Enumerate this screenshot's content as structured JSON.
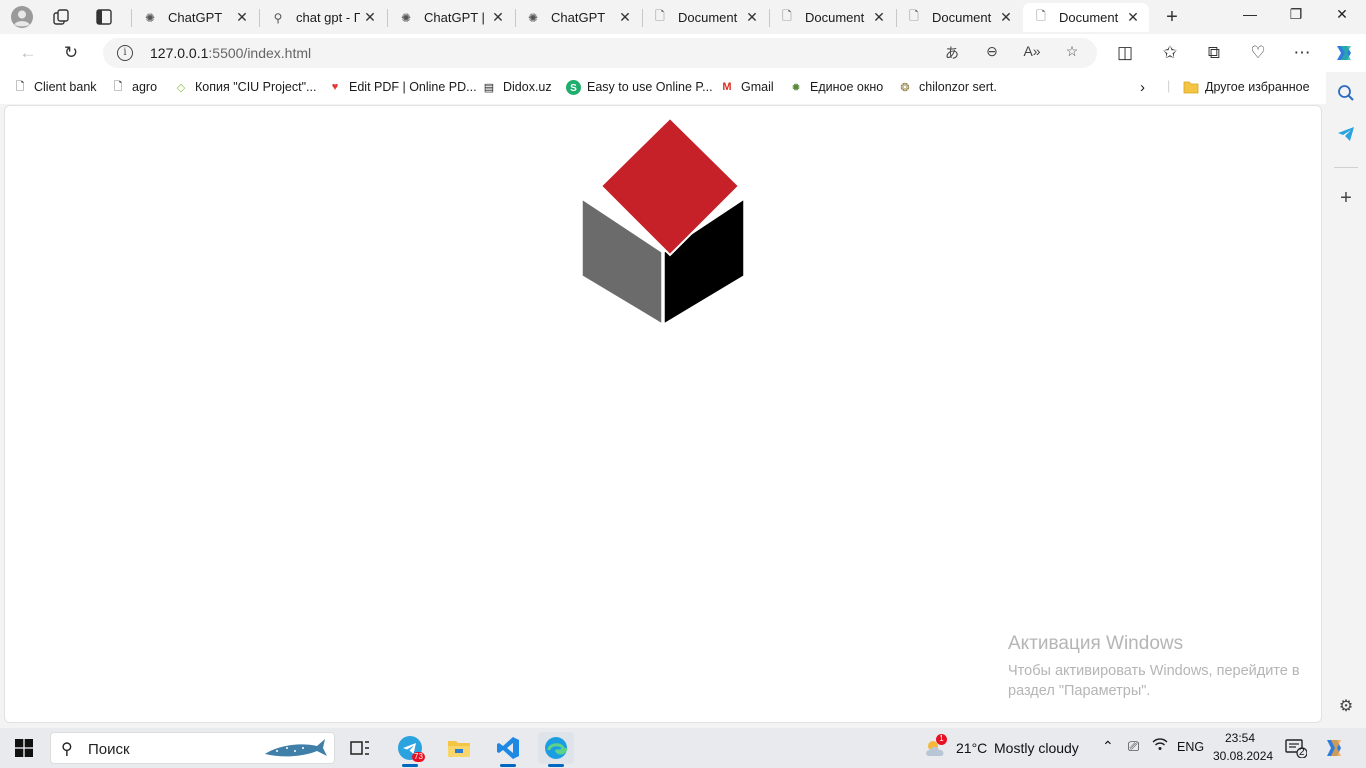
{
  "tabs": [
    {
      "label": "ChatGPT",
      "icon": "chatgpt-icon"
    },
    {
      "label": "chat gpt - По",
      "icon": "search-icon"
    },
    {
      "label": "ChatGPT | O",
      "icon": "chatgpt-icon"
    },
    {
      "label": "ChatGPT",
      "icon": "chatgpt-icon"
    },
    {
      "label": "Document",
      "icon": "page-icon"
    },
    {
      "label": "Document",
      "icon": "page-icon"
    },
    {
      "label": "Document",
      "icon": "page-icon"
    },
    {
      "label": "Document",
      "icon": "page-icon",
      "active": true
    }
  ],
  "address": {
    "host": "127.0.0.1",
    "path": ":5500/index.html"
  },
  "favorites": [
    {
      "label": "Client bank",
      "icon": "page-icon"
    },
    {
      "label": "agro",
      "icon": "page-icon"
    },
    {
      "label": "Копия \"CIU Project\"...",
      "icon": "diamond-icon"
    },
    {
      "label": "Edit PDF | Online PD...",
      "icon": "heart-icon"
    },
    {
      "label": "Didox.uz",
      "icon": "document-icon"
    },
    {
      "label": "Easy to use Online P...",
      "icon": "s-circle-icon"
    },
    {
      "label": "Gmail",
      "icon": "gmail-icon"
    },
    {
      "label": "Единое окно",
      "icon": "emblem-icon"
    },
    {
      "label": "chilonzor sert.",
      "icon": "emblem-icon"
    }
  ],
  "favorites_other": "Другое избранное",
  "page": {
    "logo": {
      "top_color": "#c62028",
      "left_color": "#6b6b6b",
      "right_color": "#000000"
    }
  },
  "activation": {
    "title": "Активация Windows",
    "message": "Чтобы активировать Windows, перейдите в раздел \"Параметры\"."
  },
  "taskbar": {
    "search_placeholder": "Поиск",
    "telegram_badge": "73",
    "weather_badge": "1",
    "temperature": "21°C",
    "weather": "Mostly cloudy",
    "language": "ENG",
    "time": "23:54",
    "date": "30.08.2024",
    "notifications": "2"
  },
  "colors": {
    "accent": "#0067c0",
    "tab_strip": "#f3f3f3"
  }
}
